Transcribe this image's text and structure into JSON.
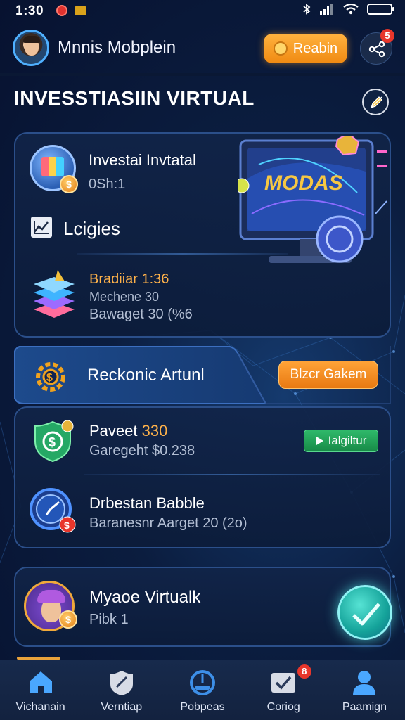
{
  "status_bar": {
    "time": "1:30"
  },
  "header": {
    "user_name": "Mnnis Mobplein",
    "reward_button": "Reabin",
    "share_badge": "5"
  },
  "section": {
    "title": "INVESSTIASIIN VIRTUAL"
  },
  "investment_card": {
    "title": "Investai Invtatal",
    "subtitle": "0Sh:1",
    "monitor_label": "MODAS",
    "logistics_label": "Lcigies",
    "item": {
      "title": "Bradiiar 1:36",
      "line1": "Mechene 30",
      "line2": "Bawaget 30 (%6"
    }
  },
  "banner": {
    "title": "Reckonic Artunl",
    "claim_button": "Blzcr Gakem"
  },
  "payment_card": {
    "item1": {
      "title_prefix": "Paveet ",
      "title_value": "330",
      "subtitle": "Garegeht $0.238",
      "action_button": "Ialgiltur"
    },
    "item2": {
      "title": "Drbestan Babble",
      "subtitle": "Baranesnr Aarget 20 (2o)"
    }
  },
  "profile_card": {
    "title": "Myaoe Virtualk",
    "subtitle": "Pibk 1"
  },
  "bottom_nav": {
    "items": [
      {
        "label": "Vichanain",
        "icon": "home-icon"
      },
      {
        "label": "Verntiap",
        "icon": "shield-icon"
      },
      {
        "label": "Pobpeas",
        "icon": "speedometer-icon"
      },
      {
        "label": "Coriog",
        "icon": "inbox-icon",
        "badge": "8"
      },
      {
        "label": "Paamign",
        "icon": "person-icon"
      }
    ]
  },
  "colors": {
    "background": "#0b1d3f",
    "accent_orange": "#f08a12",
    "accent_green": "#2fb96a",
    "accent_teal": "#15a39a",
    "card_border": "#2b4f8a"
  }
}
